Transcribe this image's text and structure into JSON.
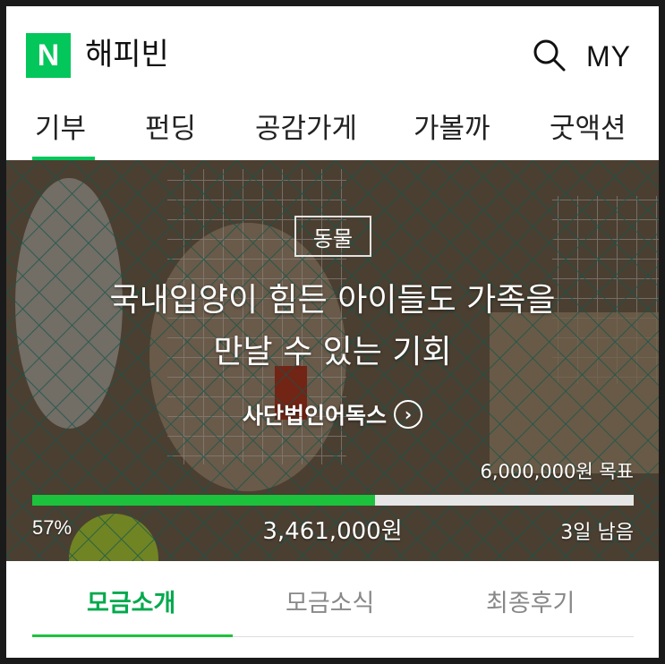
{
  "header": {
    "logo_letter": "N",
    "brand": "해피빈",
    "my_label": "MY",
    "accent_color": "#03c75a"
  },
  "nav": {
    "items": [
      {
        "label": "기부",
        "active": true
      },
      {
        "label": "펀딩"
      },
      {
        "label": "공감가게"
      },
      {
        "label": "가볼까"
      },
      {
        "label": "굿액션"
      }
    ]
  },
  "campaign": {
    "category": "동물",
    "title_line1": "국내입양이 힘든 아이들도 가족을",
    "title_line2": "만날 수 있는 기회",
    "organization": "사단법인어독스",
    "goal_text": "6,000,000원 목표",
    "progress_percent": 57,
    "percent_label": "57%",
    "raised_text": "3,461,000원",
    "remaining_text": "3일 남음"
  },
  "sub_tabs": {
    "items": [
      {
        "label": "모금소개",
        "active": true
      },
      {
        "label": "모금소식"
      },
      {
        "label": "최종후기"
      }
    ]
  }
}
